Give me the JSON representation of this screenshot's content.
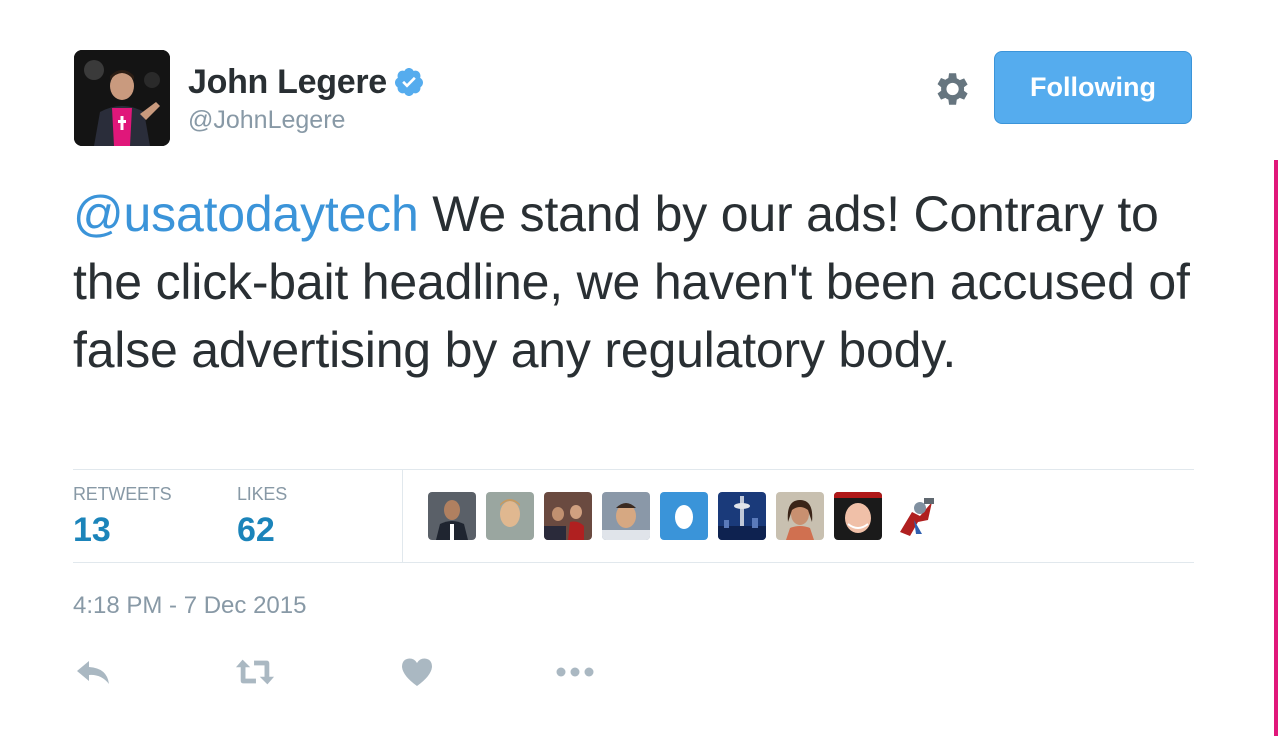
{
  "author": {
    "name": "John Legere",
    "handle": "@JohnLegere",
    "verified": true
  },
  "follow_button": {
    "label": "Following"
  },
  "tweet": {
    "mention": "@usatodaytech",
    "text": " We stand by our ads! Contrary to the click-bait headline, we haven't been accused of false advertising by any regulatory body."
  },
  "stats": {
    "retweets_label": "RETWEETS",
    "retweets_count": "13",
    "likes_label": "LIKES",
    "likes_count": "62"
  },
  "timestamp": "4:18 PM - 7 Dec 2015",
  "icons": {
    "settings": "gear-icon",
    "verified": "verified-badge-icon",
    "reply": "reply-icon",
    "retweet": "retweet-icon",
    "like": "heart-icon",
    "more": "more-dots-icon"
  },
  "colors": {
    "link": "#3b94d9",
    "count": "#1b84ba",
    "button": "#55acee",
    "muted": "#8899a6",
    "text": "#292f33"
  }
}
